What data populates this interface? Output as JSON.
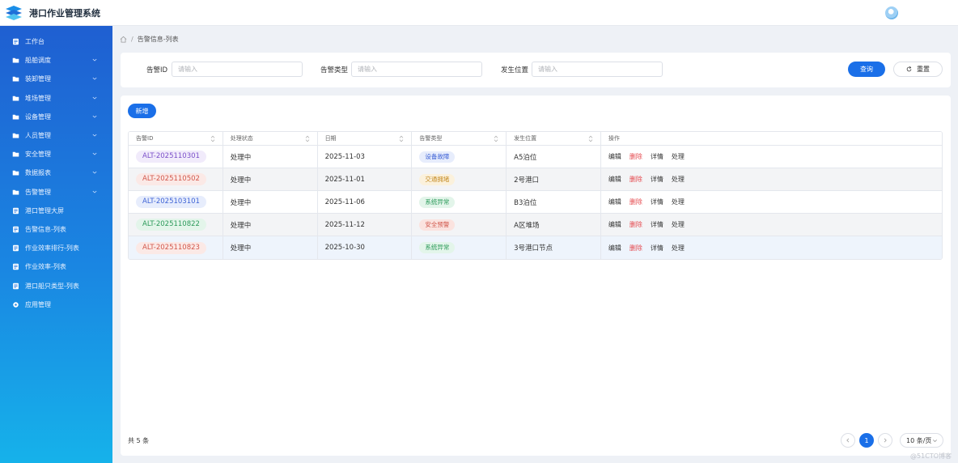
{
  "app": {
    "title": "港口作业管理系统"
  },
  "breadcrumb": {
    "current": "告警信息-列表"
  },
  "sidebar": {
    "items": [
      {
        "label": "工作台",
        "icon": "doc-icon",
        "expandable": false
      },
      {
        "label": "船舶调度",
        "icon": "folder-icon",
        "expandable": true
      },
      {
        "label": "装卸管理",
        "icon": "folder-icon",
        "expandable": true
      },
      {
        "label": "堆场管理",
        "icon": "folder-icon",
        "expandable": true
      },
      {
        "label": "设备管理",
        "icon": "folder-icon",
        "expandable": true
      },
      {
        "label": "人员管理",
        "icon": "folder-icon",
        "expandable": true
      },
      {
        "label": "安全管理",
        "icon": "folder-icon",
        "expandable": true
      },
      {
        "label": "数据报表",
        "icon": "folder-icon",
        "expandable": true
      },
      {
        "label": "告警管理",
        "icon": "folder-icon",
        "expandable": true
      },
      {
        "label": "港口管理大屏",
        "icon": "doc-icon",
        "expandable": false
      },
      {
        "label": "告警信息-列表",
        "icon": "doc-icon",
        "expandable": false
      },
      {
        "label": "作业效率排行-列表",
        "icon": "doc-icon",
        "expandable": false
      },
      {
        "label": "作业效率-列表",
        "icon": "doc-icon",
        "expandable": false
      },
      {
        "label": "港口船只类型-列表",
        "icon": "doc-icon",
        "expandable": false
      },
      {
        "label": "应用管理",
        "icon": "gear-icon",
        "expandable": false
      }
    ]
  },
  "search": {
    "fields": [
      {
        "label": "告警ID",
        "placeholder": "请输入",
        "value": ""
      },
      {
        "label": "告警类型",
        "placeholder": "请输入",
        "value": ""
      },
      {
        "label": "发生位置",
        "placeholder": "请输入",
        "value": ""
      }
    ],
    "query_label": "查询",
    "reset_label": "重置"
  },
  "toolbar": {
    "add_label": "新增"
  },
  "table": {
    "columns": [
      "告警ID",
      "处理状态",
      "日期",
      "告警类型",
      "发生位置",
      "操作"
    ],
    "actions": [
      "编辑",
      "删除",
      "详情",
      "处理"
    ],
    "rows": [
      {
        "id": "ALT-2025110301",
        "status": "处理中",
        "date": "2025-11-03",
        "type": "设备故障",
        "location": "A5泊位",
        "id_color": "#7b4fc9",
        "id_bg": "#f1ebfb",
        "type_color": "#3f63d6",
        "type_bg": "#e7edfc"
      },
      {
        "id": "ALT-2025110502",
        "status": "处理中",
        "date": "2025-11-01",
        "type": "交通拥堵",
        "location": "2号港口",
        "id_color": "#d2584c",
        "id_bg": "#fbe9e6",
        "type_color": "#c48a22",
        "type_bg": "#fbf1dc"
      },
      {
        "id": "ALT-2025103101",
        "status": "处理中",
        "date": "2025-11-06",
        "type": "系统异常",
        "location": "B3泊位",
        "id_color": "#3f63d6",
        "id_bg": "#e7edfc",
        "type_color": "#2c9a5a",
        "type_bg": "#e3f5ea"
      },
      {
        "id": "ALT-2025110822",
        "status": "处理中",
        "date": "2025-11-12",
        "type": "安全预警",
        "location": "A区堆场",
        "id_color": "#2c9a5a",
        "id_bg": "#e3f5ea",
        "type_color": "#d2584c",
        "type_bg": "#fbe3df"
      },
      {
        "id": "ALT-2025110823",
        "status": "处理中",
        "date": "2025-10-30",
        "type": "系统异常",
        "location": "3号港口节点",
        "id_color": "#d2584c",
        "id_bg": "#fbe9e6",
        "type_color": "#2c9a5a",
        "type_bg": "#e3f5ea"
      }
    ]
  },
  "pagination": {
    "total": "共 5 条",
    "current_page": "1",
    "page_size": "10 条/页"
  },
  "watermark": "@51CTO博客"
}
